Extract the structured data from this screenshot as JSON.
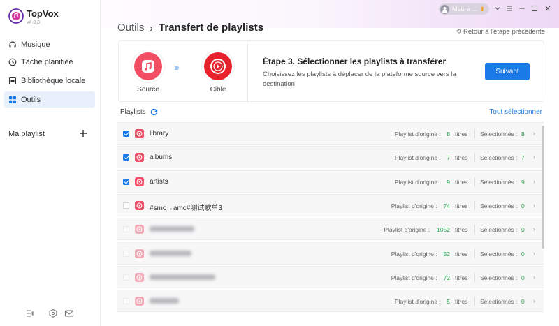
{
  "app": {
    "name": "TopVox",
    "version": "v4.0.8"
  },
  "sidebar": {
    "items": [
      {
        "label": "Musique",
        "icon": "headphones-icon"
      },
      {
        "label": "Tâche planifiée",
        "icon": "clock-icon"
      },
      {
        "label": "Bibliothèque locale",
        "icon": "folder-icon"
      },
      {
        "label": "Outils",
        "icon": "grid-icon",
        "active": true
      }
    ],
    "my_playlist_label": "Ma playlist"
  },
  "header": {
    "user_label": "Mettre ...",
    "breadcrumb": {
      "root": "Outils",
      "current": "Transfert de playlists"
    },
    "back_link": "Retour à l'étape précédente"
  },
  "step": {
    "source_label": "Source",
    "target_label": "Cible",
    "title": "Étape 3. Sélectionner les playlists à transférer",
    "description": "Choisissez les playlists à déplacer de la plateforme source vers la destination",
    "next_button": "Suivant"
  },
  "playlists": {
    "header": "Playlists",
    "select_all": "Tout sélectionner",
    "origin_label": "Playlist d'origine :",
    "tracks_unit": "titres",
    "selected_label": "Sélectionnés :",
    "rows": [
      {
        "name": "library",
        "origin": "8",
        "selected": "8",
        "checked": true,
        "blurred": false
      },
      {
        "name": "albums",
        "origin": "7",
        "selected": "7",
        "checked": true,
        "blurred": false
      },
      {
        "name": "artists",
        "origin": "9",
        "selected": "9",
        "checked": true,
        "blurred": false
      },
      {
        "name": "#smc→amc#测试歌单3",
        "origin": "74",
        "selected": "0",
        "checked": false,
        "blurred": false
      },
      {
        "name": "",
        "origin": "1052",
        "selected": "0",
        "checked": false,
        "blurred": true
      },
      {
        "name": "",
        "origin": "52",
        "selected": "0",
        "checked": false,
        "blurred": true
      },
      {
        "name": "",
        "origin": "72",
        "selected": "0",
        "checked": false,
        "blurred": true
      },
      {
        "name": "",
        "origin": "5",
        "selected": "0",
        "checked": false,
        "blurred": true
      }
    ]
  },
  "colors": {
    "accent": "#1a7ae8",
    "count_green": "#2aa84f",
    "source_red": "#f24e63",
    "target_red": "#e8222c"
  }
}
